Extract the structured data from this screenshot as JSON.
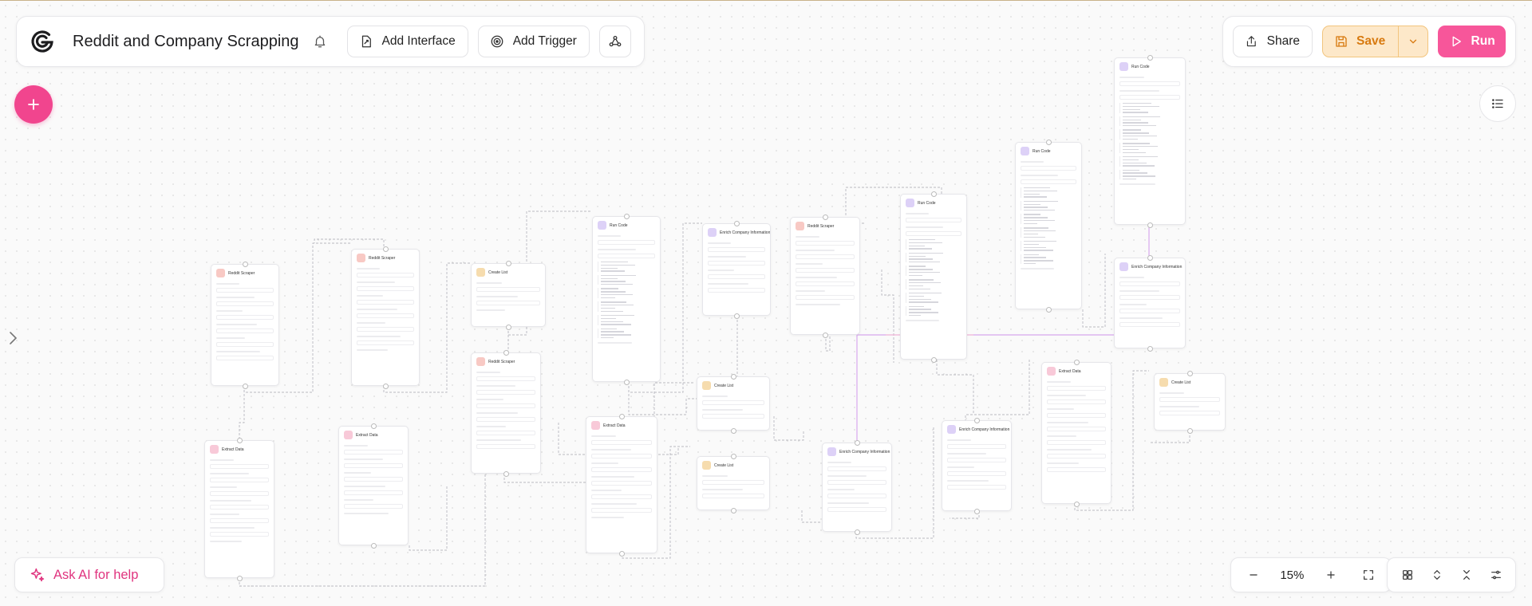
{
  "header": {
    "app_logo_icon": "g-logo-icon",
    "title": "Reddit and Company Scrapping",
    "bell_icon": "bell-icon",
    "add_interface_label": "Add Interface",
    "add_trigger_label": "Add Trigger",
    "webhook_icon": "webhook-icon"
  },
  "actions": {
    "share_label": "Share",
    "save_label": "Save",
    "run_label": "Run"
  },
  "assistant": {
    "ask_ai_label": "Ask AI for help"
  },
  "zoom": {
    "value": "15%"
  },
  "colors": {
    "accent_pink": "#f1458e",
    "save_bg": "#fde8c9",
    "save_text": "#d87a10"
  },
  "canvas": {
    "nodes": [
      {
        "kind": "reddit",
        "color": "#f8c9c4",
        "title": "Reddit Scraper"
      },
      {
        "kind": "extract",
        "color": "#f8c9d8",
        "title": "Extract Data"
      },
      {
        "kind": "reddit",
        "color": "#f8c9c4",
        "title": "Reddit Scraper"
      },
      {
        "kind": "extract",
        "color": "#f8c9d8",
        "title": "Extract Data"
      },
      {
        "kind": "list",
        "color": "#f6dcae",
        "title": "Create List"
      },
      {
        "kind": "reddit",
        "color": "#f8c9c4",
        "title": "Reddit Scraper"
      },
      {
        "kind": "code",
        "color": "#ddd1f7",
        "title": "Run Code"
      },
      {
        "kind": "extract",
        "color": "#f8c9d8",
        "title": "Extract Data"
      },
      {
        "kind": "company",
        "color": "#ddd1f7",
        "title": "Enrich Company Information"
      },
      {
        "kind": "list",
        "color": "#f6dcae",
        "title": "Create List"
      },
      {
        "kind": "list",
        "color": "#f6dcae",
        "title": "Create List"
      },
      {
        "kind": "reddit",
        "color": "#f8c9c4",
        "title": "Reddit Scraper"
      },
      {
        "kind": "company",
        "color": "#ddd1f7",
        "title": "Enrich Company Information"
      },
      {
        "kind": "code",
        "color": "#ddd1f7",
        "title": "Run Code"
      },
      {
        "kind": "company",
        "color": "#ddd1f7",
        "title": "Enrich Company Information"
      },
      {
        "kind": "code",
        "color": "#ddd1f7",
        "title": "Run Code"
      },
      {
        "kind": "extract",
        "color": "#f8c9d8",
        "title": "Extract Data"
      },
      {
        "kind": "code",
        "color": "#ddd1f7",
        "title": "Run Code"
      },
      {
        "kind": "company",
        "color": "#ddd1f7",
        "title": "Enrich Company Information"
      },
      {
        "kind": "list",
        "color": "#f6dcae",
        "title": "Create List"
      }
    ]
  }
}
